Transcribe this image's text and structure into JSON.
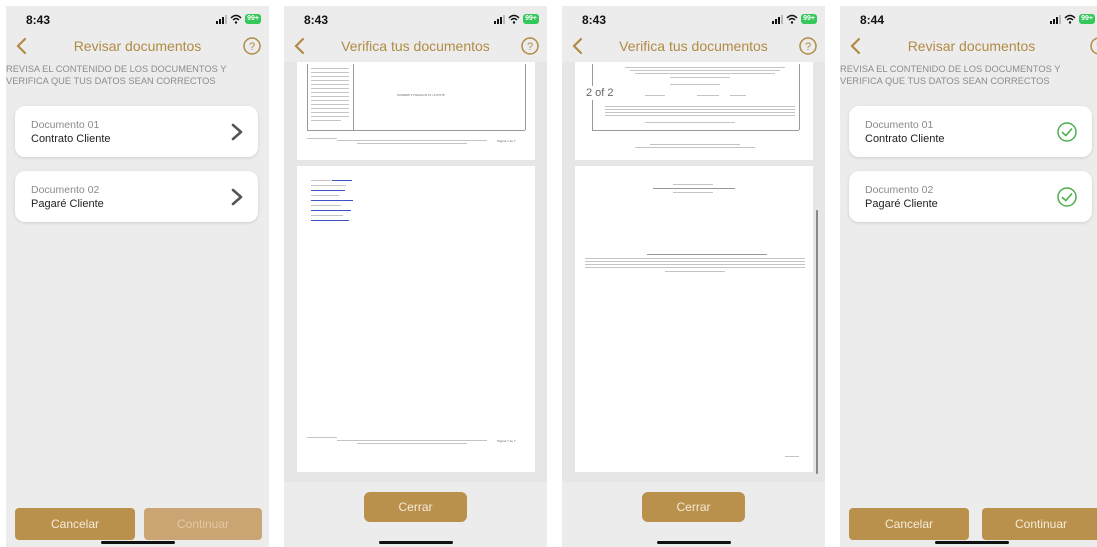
{
  "screens": [
    {
      "time": "8:43",
      "battery": "99+",
      "title": "Revisar documentos",
      "instructions": "REVISA EL CONTENIDO DE LOS DOCUMENTOS Y VERIFICA QUE TUS DATOS SEAN CORRECTOS",
      "documents": [
        {
          "number": "Documento 01",
          "name": "Contrato Cliente",
          "icon": "chevron-right-icon"
        },
        {
          "number": "Documento 02",
          "name": "Pagaré Cliente",
          "icon": "chevron-right-icon"
        }
      ],
      "cancel_label": "Cancelar",
      "continue_label": "Continuar",
      "continue_enabled": false
    },
    {
      "time": "8:43",
      "battery": "99+",
      "title": "Verifica tus documentos",
      "page_small_text": [
        "NOMBRE Y FIRMA DE EL CLIENTE",
        "Página 1 de 7",
        "Página 7 de 7"
      ],
      "close_label": "Cerrar"
    },
    {
      "time": "8:43",
      "battery": "99+",
      "title": "Verifica tus documentos",
      "page_indicator": "2 of 2",
      "close_label": "Cerrar"
    },
    {
      "time": "8:44",
      "battery": "99+",
      "title": "Revisar documentos",
      "instructions": "REVISA EL CONTENIDO DE LOS DOCUMENTOS Y VERIFICA QUE TUS DATOS SEAN CORRECTOS",
      "documents": [
        {
          "number": "Documento 01",
          "name": "Contrato Cliente",
          "icon": "check-circle-icon"
        },
        {
          "number": "Documento 02",
          "name": "Pagaré Cliente",
          "icon": "check-circle-icon"
        }
      ],
      "cancel_label": "Cancelar",
      "continue_label": "Continuar",
      "continue_enabled": true
    }
  ],
  "colors": {
    "accent": "#b9904c",
    "accent_disabled": "#cba473",
    "check_green": "#4cae4c",
    "battery_green": "#34c759"
  }
}
